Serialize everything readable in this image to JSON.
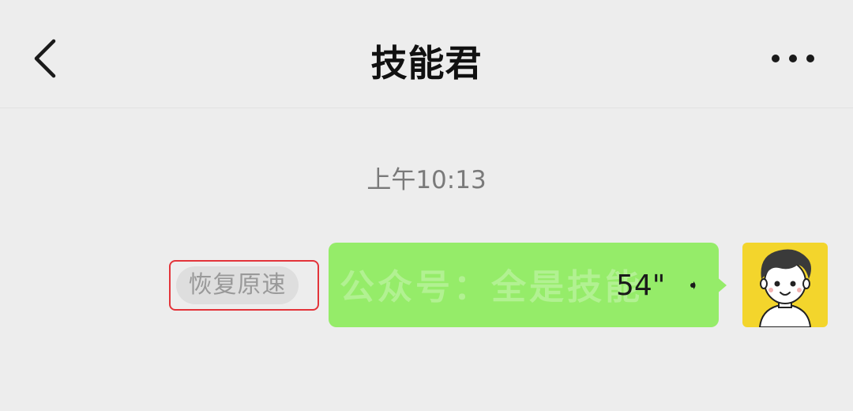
{
  "header": {
    "title": "技能君",
    "back_icon": "chevron-left-icon",
    "more_icon": "ellipsis-icon"
  },
  "chat": {
    "timestamp": "上午10:13",
    "messages": [
      {
        "type": "voice",
        "sender": "self",
        "duration": "54\"",
        "watermark": "公众号：全是技能",
        "restore_label": "恢复原速"
      }
    ]
  },
  "colors": {
    "background": "#ededed",
    "bubble": "#95ec69",
    "highlight": "#e3343a",
    "avatar_bg": "#f3d52c"
  }
}
